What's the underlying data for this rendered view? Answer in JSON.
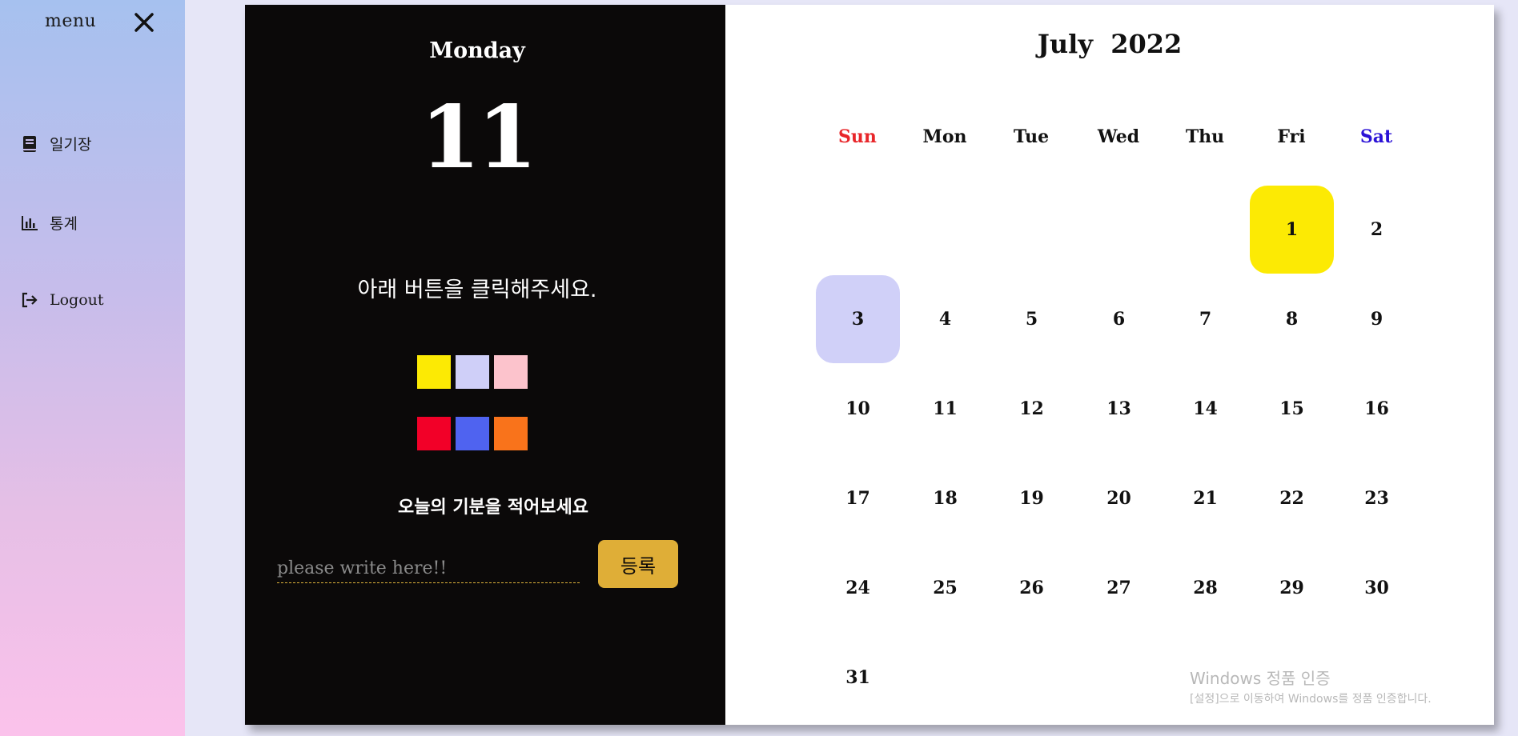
{
  "sidebar": {
    "menu_title": "menu",
    "items": [
      {
        "label": "일기장",
        "icon": "book-icon"
      },
      {
        "label": "통계",
        "icon": "bar-chart-icon"
      },
      {
        "label": "Logout",
        "icon": "logout-icon"
      }
    ]
  },
  "diary": {
    "day_name": "Monday",
    "day_number": "11",
    "prompt": "아래 버튼을 클릭해주세요.",
    "mood_colors": [
      "#fcea04",
      "#cfcff8",
      "#fcc3cc",
      "#f20028",
      "#4f63f0",
      "#f9731b"
    ],
    "mood_label": "오늘의 기분을 적어보세요",
    "input_placeholder": "please write here!!",
    "input_value": "",
    "submit_label": "등록"
  },
  "calendar": {
    "month": "July",
    "year": "2022",
    "weekdays": [
      "Sun",
      "Mon",
      "Tue",
      "Wed",
      "Thu",
      "Fri",
      "Sat"
    ],
    "weekday_colors": {
      "Sun": "#e8262a",
      "Sat": "#2b12d6"
    },
    "first_weekday_index": 5,
    "days_in_month": 31,
    "highlights": {
      "1": "#fcea04",
      "3": "#d0d0f8"
    }
  },
  "watermark": {
    "line1": "Windows 정품 인증",
    "line2": "[설정]으로 이동하여 Windows를 정품 인증합니다."
  }
}
